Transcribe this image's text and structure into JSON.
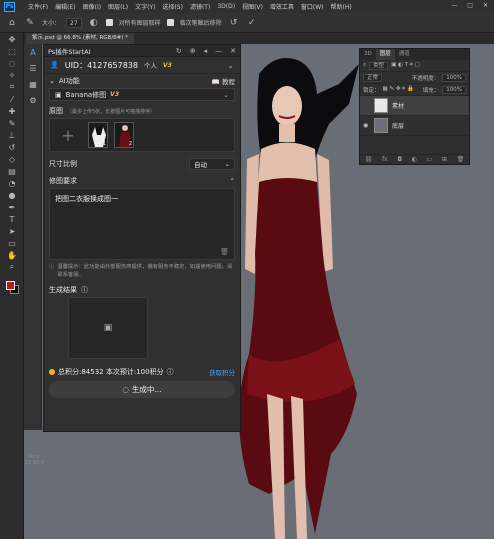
{
  "menubar": {
    "items": [
      "文件(F)",
      "编辑(E)",
      "图像(I)",
      "图层(L)",
      "文字(Y)",
      "选择(S)",
      "滤镜(T)",
      "3D(D)",
      "视图(V)",
      "增效工具",
      "窗口(W)",
      "帮助(H)"
    ],
    "logo": "Ps"
  },
  "options": {
    "size_label": "大小：",
    "size_value": "27",
    "sample_all_layers": "对所有图层取样",
    "auto_erase": "临次笔触后移除"
  },
  "doc_tab": "紫示.psd @ 66.8% (素材, RGB/8#) *",
  "plugin": {
    "title": "Ps插件StartAI",
    "uid_label": "UID：4127657838",
    "tier": "个人",
    "tier_version": "V3",
    "ai_function_label": "AI功能",
    "tutorial": "教程",
    "model_name": "Banana修图",
    "model_version": "V3",
    "source_label": "原图",
    "source_hint": "（最多上传5张，长按图片可拖拽排序）",
    "thumbs": [
      "1",
      "2"
    ],
    "ratio_label": "尺寸比例",
    "ratio_value": "自动",
    "requirement_label": "修图要求",
    "prompt_text": "把图二衣服换成图一",
    "notice": "温馨提示：此功能由外部服务商提供，偶有服务不稳定，如遇使用问题，请联系客服。",
    "result_label": "生成结果",
    "credits_text": "总积分:84532 本次预计:100积分",
    "get_credits": "获取积分",
    "generate": "生成中..."
  },
  "side_version": "Ams 15.20.4",
  "layers_panel": {
    "tabs": [
      "3D",
      "图层",
      "通道"
    ],
    "filter": "类型",
    "mode": "正常",
    "opacity_label": "不透明度：",
    "opacity_value": "100%",
    "lock_label": "锁定：",
    "fill_label": "填充：",
    "fill_value": "100%",
    "layers": [
      "素材",
      "底层"
    ]
  },
  "colors": {
    "accent": "#31a8ff",
    "v3_badge": "#f0b93a",
    "link": "#4a9fff",
    "foreground_swatch": "#c0151d",
    "canvas_bg": "#686d76"
  }
}
